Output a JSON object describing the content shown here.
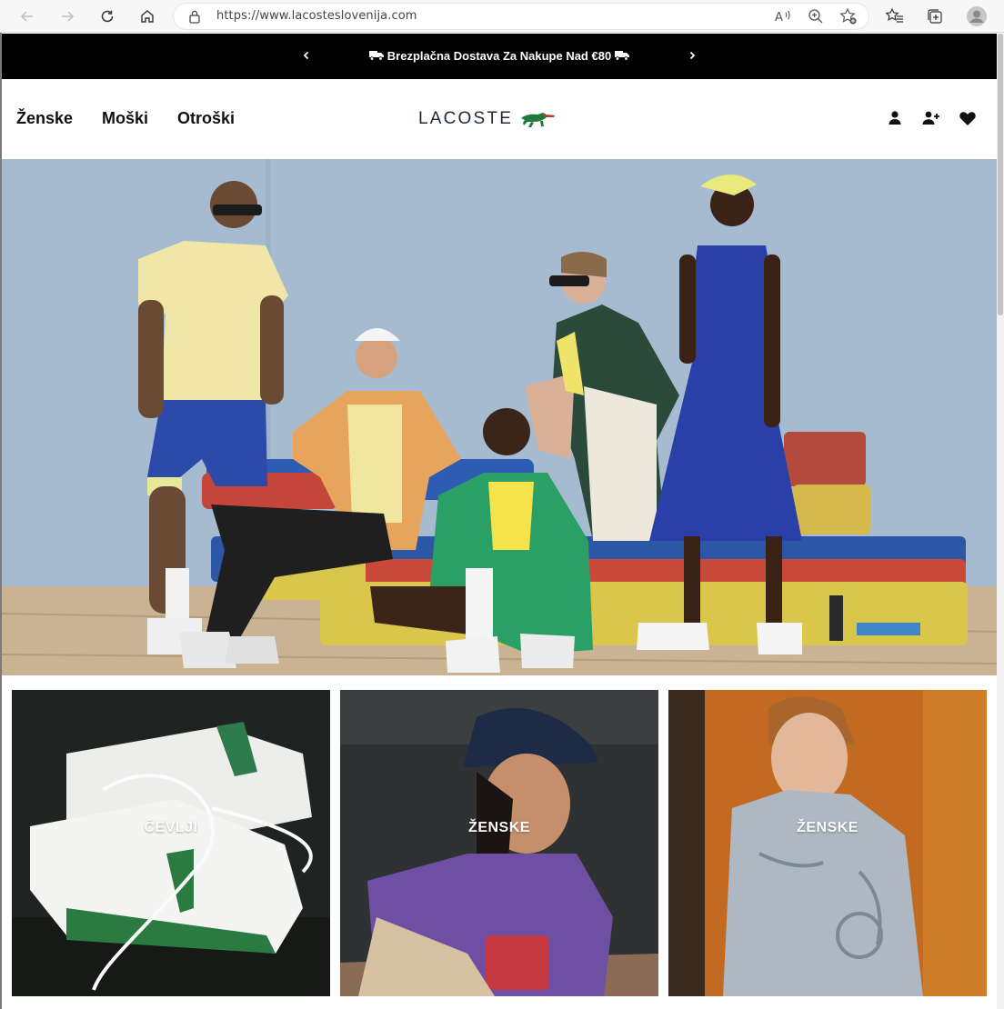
{
  "browser": {
    "url": "https://www.lacosteslovenija.com",
    "icons": [
      "back-icon",
      "forward-icon",
      "reload-icon",
      "home-icon",
      "lock-icon",
      "read-aloud-icon",
      "zoom-icon",
      "add-favorite-icon",
      "favorites-icon",
      "collections-icon",
      "profile-icon"
    ]
  },
  "promo": {
    "text": "Brezplačna Dostava Za Nakupe Nad €80",
    "icons": [
      "truck-icon",
      "chevron-left-icon",
      "chevron-right-icon"
    ]
  },
  "header": {
    "nav": [
      "Ženske",
      "Moški",
      "Otroški"
    ],
    "logo_text": "LACOSTE",
    "icons": [
      "account-icon",
      "register-icon",
      "wishlist-heart-icon"
    ],
    "brand_color": "#0b7a3b"
  },
  "tiles": [
    {
      "label": "ČEVLJI"
    },
    {
      "label": "ŽENSKE"
    },
    {
      "label": "ŽENSKE"
    }
  ],
  "colors": {
    "promo_bg": "#000000",
    "text": "#111111",
    "logo_green": "#1f7a3d"
  }
}
